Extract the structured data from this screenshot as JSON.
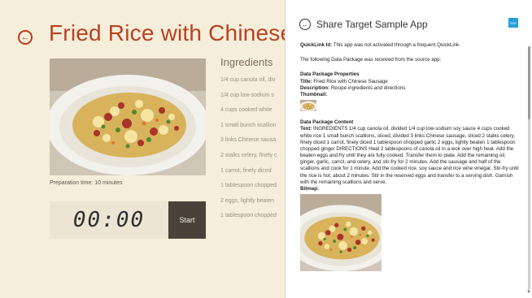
{
  "app": {
    "title": "Fried Rice with Chinese S",
    "prep_time": "Preparation time: 10 minutes",
    "timer": "00:00",
    "start_label": "Start",
    "ingredients_heading": "Ingredients",
    "ingredients": [
      "1/4 cup canola oil, div",
      "1/4 cup low-sodium s",
      "4 cups cooked white",
      "1 small bunch scallion",
      "3 links Chinese sausa",
      "2 stalks celery, finely c",
      "1 carrot, finely diced",
      "1 tablespoon chopped",
      "2 eggs, lightly beaten",
      "1 tablespoon chopped"
    ]
  },
  "pane": {
    "title": "Share Target Sample App",
    "logo_text": "SDK",
    "quicklink_label": "QuickLink Id:",
    "quicklink_text": " This app was not activated through a frequent QuickLink.",
    "received_text": "The following Data Package was received from the source app:",
    "props_heading": "Data Package Properties",
    "title_label": "Title:",
    "title_value": " Fried Rice with Chinese Sausage",
    "desc_label": "Description:",
    "desc_value": " Recipe ingredients and directions",
    "thumbnail_label": "Thumbnail:",
    "content_heading": "Data Package Content",
    "text_label": "Text:",
    "text_value": " INGREDIENTS 1/4 cup canola oil, divided 1/4 cup low-sodium soy sauce 4 cups cooked white rice 1 small bunch scallions, sliced, divided 3 links Chinese sausage, sliced 2 stalks celery, finely diced 1 carrot, finely diced 1 tablespoon chopped garlic 2 eggs, lightly beaten 1 tablespoon chopped ginger DIRECTIONS Heat 2 tablespoons of canola oil in a wok over high heat. Add the beaten eggs and fry until they are fully cooked. Transfer them to plate. Add the remaining oil, ginger, garlic, carrot, and celery, and stir-fry for 2 minutes. Add the sausage and half of the scallions and cook for 1 minute. Add the cooked rice, soy sauce and rice wine vinegar. Stir-fry until the rice is hot, about 2 minutes. Stir in the reserved eggs and transfer to a serving dish. Garnish with the remaining scallions and serve.",
    "bitmap_label": "Bitmap:"
  },
  "colors": {
    "accent": "#b8421f",
    "app_bg": "#f5eedb",
    "start_bg": "#4a4239",
    "logo_bg": "#26a0da"
  }
}
